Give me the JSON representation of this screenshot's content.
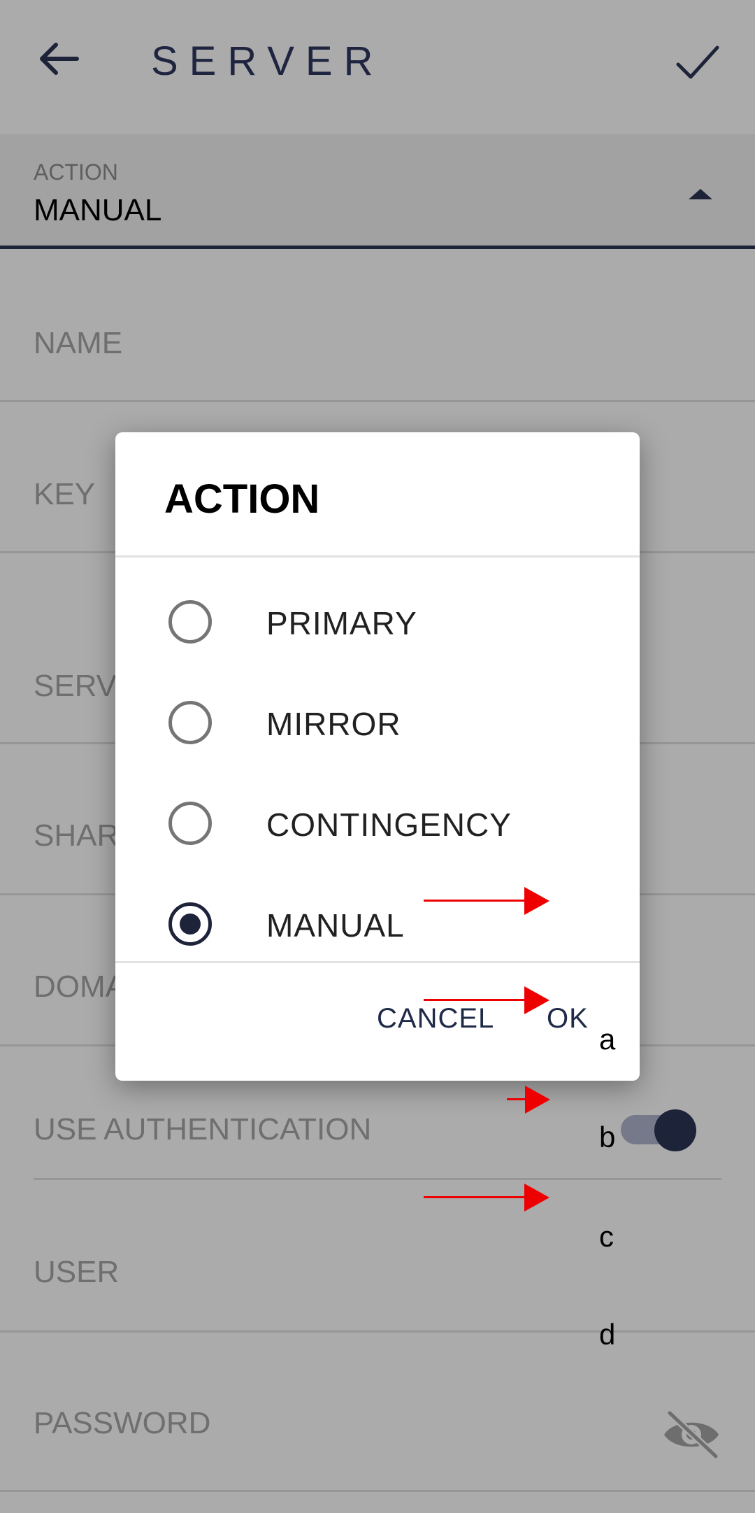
{
  "header": {
    "title": "SERVER"
  },
  "action_field": {
    "label": "ACTION",
    "value": "MANUAL"
  },
  "fields": {
    "name": "NAME",
    "key": "KEY",
    "server": "SERV",
    "share": "SHAR",
    "domain": "DOMA",
    "use_authentication": "USE AUTHENTICATION",
    "user": "USER",
    "password": "PASSWORD"
  },
  "toggle": {
    "use_authentication_on": true
  },
  "dialog": {
    "title": "ACTION",
    "options": [
      {
        "label": "PRIMARY",
        "selected": false,
        "marker": "a"
      },
      {
        "label": "MIRROR",
        "selected": false,
        "marker": "b"
      },
      {
        "label": "CONTINGENCY",
        "selected": false,
        "marker": "c"
      },
      {
        "label": "MANUAL",
        "selected": true,
        "marker": "d"
      }
    ],
    "cancel_label": "CANCEL",
    "ok_label": "OK"
  },
  "colors": {
    "accent": "#1d2338",
    "annotation_arrow": "#ee0000"
  }
}
